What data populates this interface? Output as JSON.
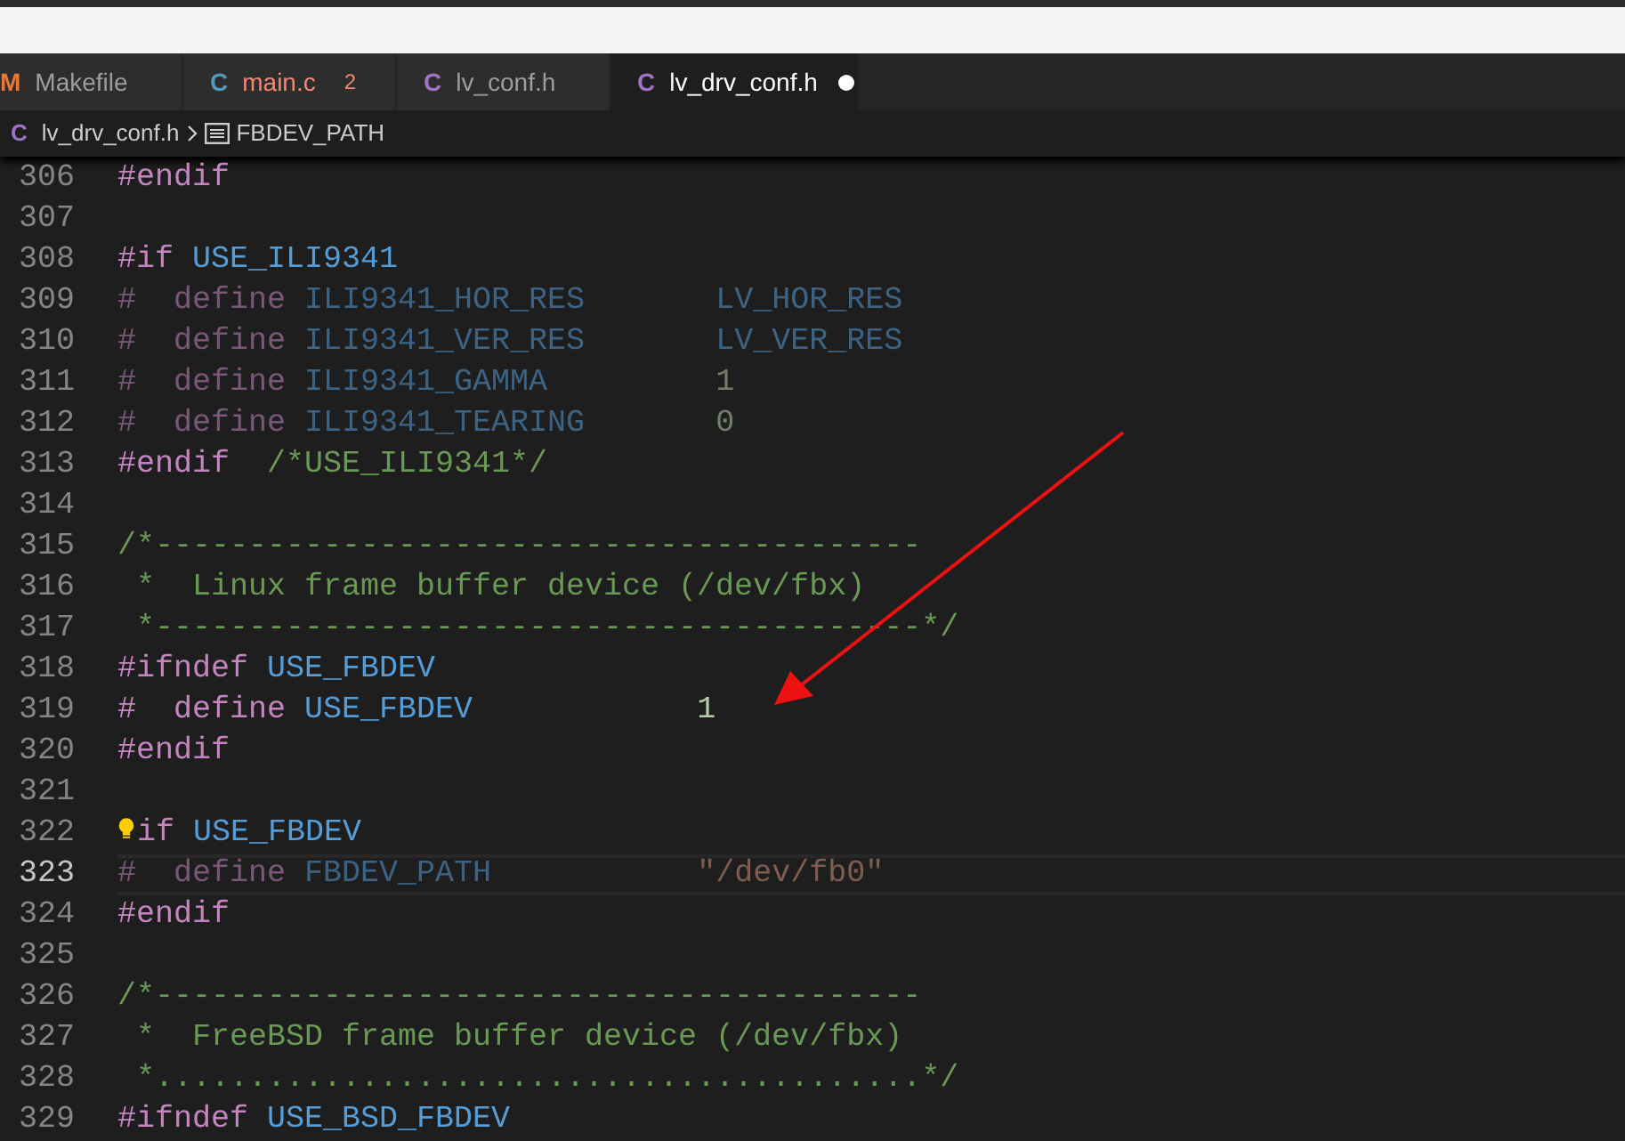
{
  "tabs": [
    {
      "icon": "M",
      "color": "#e37933",
      "label": "Makefile",
      "selected": false
    },
    {
      "icon": "C",
      "color": "#519aba",
      "label": "main.c",
      "has_errors": true,
      "error_count": "2",
      "selected": false
    },
    {
      "icon": "C",
      "color": "#a074c4",
      "label": "lv_conf.h",
      "selected": false
    },
    {
      "icon": "C",
      "color": "#a074c4",
      "label": "lv_drv_conf.h",
      "modified": true,
      "selected": true
    }
  ],
  "breadcrumb": {
    "file_icon": "C",
    "file": "lv_drv_conf.h",
    "symbol": "FBDEV_PATH"
  },
  "lines": [
    {
      "number": "306",
      "tokens": [
        {
          "kind": "directive",
          "text": "#endif"
        }
      ]
    },
    {
      "number": "307"
    },
    {
      "number": "308",
      "tokens": [
        {
          "kind": "directive",
          "text": "#if "
        },
        {
          "kind": "macro",
          "text": "USE_ILI9341"
        }
      ]
    },
    {
      "number": "309",
      "inactive": true,
      "tokens": [
        {
          "kind": "directive",
          "text": "#  define "
        },
        {
          "kind": "macro",
          "text": "ILI9341_HOR_RES       "
        },
        {
          "kind": "macro",
          "text": "LV_HOR_RES"
        }
      ]
    },
    {
      "number": "310",
      "inactive": true,
      "tokens": [
        {
          "kind": "directive",
          "text": "#  define "
        },
        {
          "kind": "macro",
          "text": "ILI9341_VER_RES       "
        },
        {
          "kind": "macro",
          "text": "LV_VER_RES"
        }
      ]
    },
    {
      "number": "311",
      "inactive": true,
      "tokens": [
        {
          "kind": "directive",
          "text": "#  define "
        },
        {
          "kind": "macro",
          "text": "ILI9341_GAMMA         "
        },
        {
          "kind": "number",
          "text": "1"
        }
      ]
    },
    {
      "number": "312",
      "inactive": true,
      "tokens": [
        {
          "kind": "directive",
          "text": "#  define "
        },
        {
          "kind": "macro",
          "text": "ILI9341_TEARING       "
        },
        {
          "kind": "number",
          "text": "0"
        }
      ]
    },
    {
      "number": "313",
      "tokens": [
        {
          "kind": "directive",
          "text": "#endif  "
        },
        {
          "kind": "comment",
          "text": "/*USE_ILI9341*/"
        }
      ]
    },
    {
      "number": "314"
    },
    {
      "number": "315",
      "tokens": [
        {
          "kind": "comment",
          "text": "/*-----------------------------------------"
        }
      ]
    },
    {
      "number": "316",
      "tokens": [
        {
          "kind": "comment",
          "text": " *  Linux frame buffer device (/dev/fbx)"
        }
      ]
    },
    {
      "number": "317",
      "tokens": [
        {
          "kind": "comment",
          "text": " *-----------------------------------------*/"
        }
      ]
    },
    {
      "number": "318",
      "tokens": [
        {
          "kind": "directive",
          "text": "#ifndef "
        },
        {
          "kind": "macro",
          "text": "USE_FBDEV"
        }
      ]
    },
    {
      "number": "319",
      "tokens": [
        {
          "kind": "directive",
          "text": "#  define "
        },
        {
          "kind": "macro",
          "text": "USE_FBDEV            "
        },
        {
          "kind": "number",
          "text": "1"
        }
      ]
    },
    {
      "number": "320",
      "tokens": [
        {
          "kind": "directive",
          "text": "#endif"
        }
      ]
    },
    {
      "number": "321"
    },
    {
      "number": "322",
      "lightbulb": true,
      "tokens": [
        {
          "kind": "directive",
          "text": "if "
        },
        {
          "kind": "macro",
          "text": "USE_FBDEV"
        }
      ]
    },
    {
      "number": "323",
      "current": true,
      "inactive": true,
      "tokens": [
        {
          "kind": "directive",
          "text": "#  define "
        },
        {
          "kind": "macro",
          "text": "FBDEV_PATH           "
        },
        {
          "kind": "string",
          "text": "\"/dev/fb0\""
        }
      ]
    },
    {
      "number": "324",
      "tokens": [
        {
          "kind": "directive",
          "text": "#endif"
        }
      ]
    },
    {
      "number": "325"
    },
    {
      "number": "326",
      "tokens": [
        {
          "kind": "comment",
          "text": "/*-----------------------------------------"
        }
      ]
    },
    {
      "number": "327",
      "tokens": [
        {
          "kind": "comment",
          "text": " *  FreeBSD frame buffer device (/dev/fbx)"
        }
      ]
    },
    {
      "number": "328",
      "tokens": [
        {
          "kind": "comment",
          "text": " *.........................................*/"
        }
      ]
    },
    {
      "number": "329",
      "tokens": [
        {
          "kind": "directive",
          "text": "#ifndef "
        },
        {
          "kind": "macro",
          "text": "USE_BSD_FBDEV"
        }
      ]
    }
  ]
}
